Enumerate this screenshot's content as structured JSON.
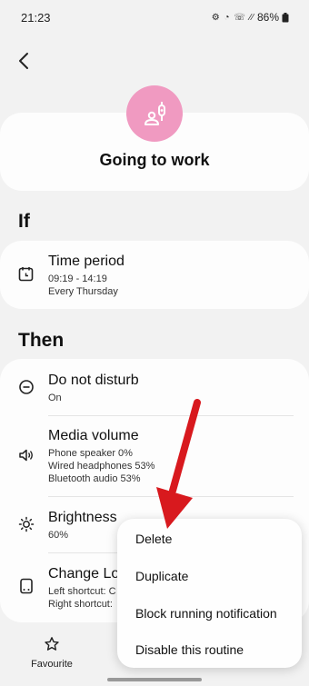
{
  "status": {
    "time": "21:23",
    "icons": "⚙ ◔ ☏ ∕∕",
    "battery": "86%"
  },
  "routine": {
    "title": "Going to work"
  },
  "if_section": {
    "heading": "If",
    "items": [
      {
        "title": "Time period",
        "lines": [
          "09:19 - 14:19",
          "Every Thursday"
        ]
      }
    ]
  },
  "then_section": {
    "heading": "Then",
    "items": [
      {
        "title": "Do not disturb",
        "lines": [
          "On"
        ]
      },
      {
        "title": "Media volume",
        "lines": [
          "Phone speaker 0%",
          "Wired headphones 53%",
          "Bluetooth audio 53%"
        ]
      },
      {
        "title": "Brightness",
        "lines": [
          "60%"
        ]
      },
      {
        "title": "Change Lo",
        "lines": [
          "Left shortcut: C",
          "Right shortcut:"
        ]
      }
    ]
  },
  "menu": {
    "items": [
      "Delete",
      "Duplicate",
      "Block running notification",
      "Disable this routine"
    ]
  },
  "bottom_nav": {
    "favourite_label": "Favourite"
  },
  "colors": {
    "accent_pink": "#f09ac1",
    "arrow_red": "#d8191e"
  }
}
